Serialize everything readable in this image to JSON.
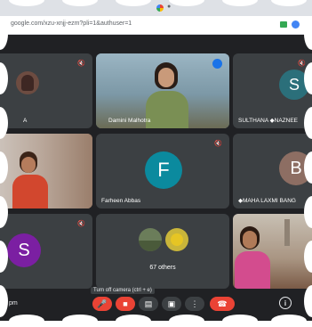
{
  "browser": {
    "url": "google.com/xzu-xnjj-ezm?pli=1&authuser=1"
  },
  "tiles": {
    "t1": {
      "name": "A"
    },
    "t2": {
      "name": "Damini Malhotra"
    },
    "t3": {
      "name": "SULTHANA ◆NAZNEE",
      "initial": "S"
    },
    "t5": {
      "name": "Farheen Abbas",
      "initial": "F"
    },
    "t6": {
      "name": "◆MAHA LAXMI BANG",
      "initial": "B"
    },
    "t7": {
      "initial": "S"
    },
    "t8": {
      "others": "67 others"
    }
  },
  "toolbar": {
    "tooltip": "Turn off camera (ctrl + e)",
    "time": "pm"
  },
  "colors": {
    "tile": "#3c4043",
    "avatar_s_teal": "#2b6f7a",
    "avatar_f_teal": "#0b8a9e",
    "avatar_b_brown": "#8d6e63",
    "avatar_s_purple": "#7b1fa2",
    "end_call_red": "#ea4335"
  },
  "icons": {
    "mic_muted": "mic-off-icon",
    "end_call": "call-end-icon",
    "info": "info-icon"
  }
}
